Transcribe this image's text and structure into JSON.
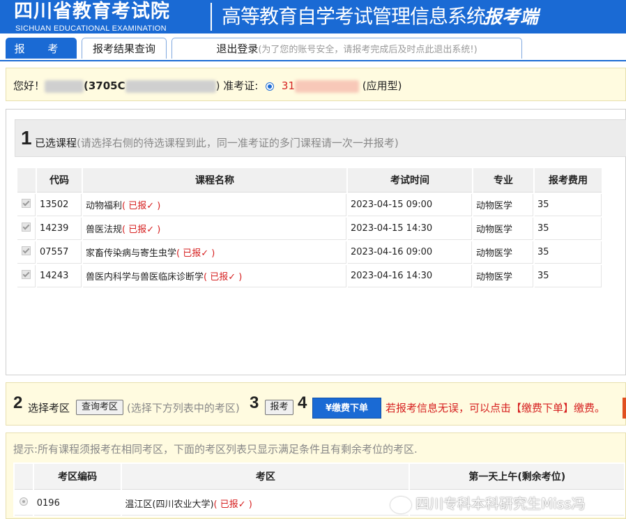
{
  "header": {
    "org_title": "四川省教育考试院",
    "org_subtitle": "SICHUAN EDUCATIONAL EXAMINATION",
    "system_title": "高等教育自学考试管理信息系统",
    "system_tag": "报考端"
  },
  "tabs": [
    {
      "label": "报 考",
      "active": true
    },
    {
      "label": "报考结果查询",
      "active": false
    },
    {
      "label": "退出登录",
      "note": "(为了您的账号安全，请报考完成后及时点此退出系统!)",
      "active": false
    }
  ],
  "greeting": {
    "hello": "您好！",
    "id_prefix": "(3705C",
    "id_suffix": ")",
    "ticket_label": "准考证:",
    "ticket_prefix": "31",
    "ticket_type": "(应用型)"
  },
  "selected": {
    "step": "1",
    "title": "已选课程",
    "hint": "(请选择右侧的待选课程到此，同一准考证的多门课程请一次一并报考)",
    "columns": [
      "代码",
      "课程名称",
      "考试时间",
      "专业",
      "报考费用"
    ],
    "rows": [
      {
        "code": "13502",
        "name": "动物福利",
        "status": "( 已报✓ )",
        "time": "2023-04-15 09:00",
        "major": "动物医学",
        "fee": "35"
      },
      {
        "code": "14239",
        "name": "兽医法规",
        "status": "( 已报✓ )",
        "time": "2023-04-15 14:30",
        "major": "动物医学",
        "fee": "35"
      },
      {
        "code": "07557",
        "name": "家畜传染病与寄生虫学",
        "status": "( 已报✓ )",
        "time": "2023-04-16 09:00",
        "major": "动物医学",
        "fee": "35"
      },
      {
        "code": "14243",
        "name": "兽医内科学与兽医临床诊断学",
        "status": "( 已报✓ )",
        "time": "2023-04-16 14:30",
        "major": "动物医学",
        "fee": "35"
      }
    ]
  },
  "actions": {
    "step2": "2",
    "choose_area": "选择考区",
    "query_area_button": "查询考区",
    "area_hint": "(选择下方列表中的考区)",
    "step3": "3",
    "register_button": "报考",
    "step4": "4",
    "pay_button": "¥缴费下单",
    "pay_notice": "若报考信息无误，可以点击【缴费下单】缴费。"
  },
  "areas": {
    "tip": "提示:所有课程须报考在相同考区，下面的考区列表只显示满足条件且有剩余考位的考区.",
    "columns": [
      "考区编码",
      "考区",
      "第一天上午(剩余考位)"
    ],
    "rows": [
      {
        "code": "0196",
        "name": "温江区(四川农业大学)",
        "status": "( 已报✓ )",
        "seats": ""
      }
    ]
  },
  "watermark": "四川专科本科研究生Miss冯",
  "colors": {
    "brand": "#1a6ad4",
    "alert": "#d62020",
    "panel_bg": "#fffbe0"
  }
}
